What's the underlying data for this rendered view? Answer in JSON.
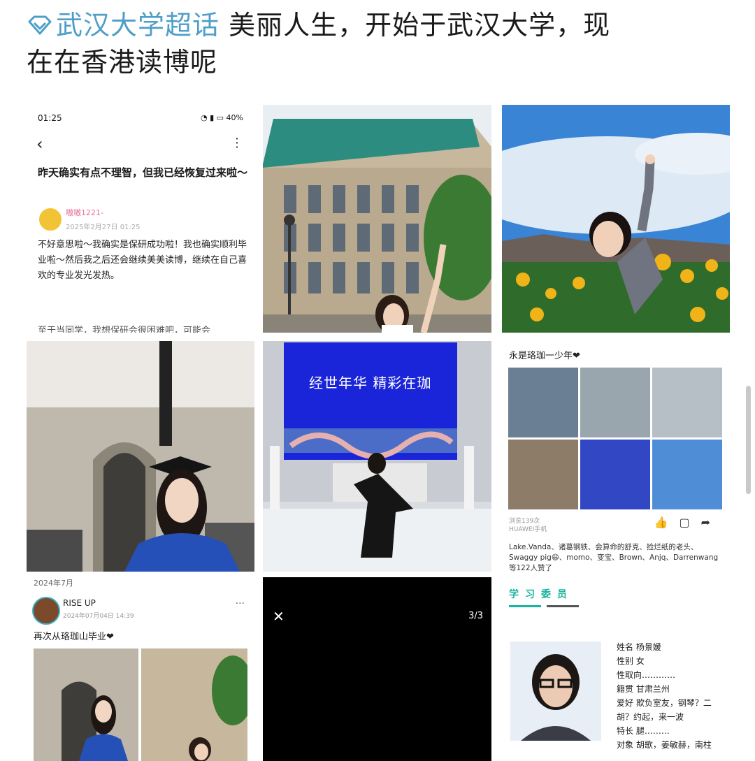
{
  "header": {
    "topic": "武汉大学超话",
    "text_line1": "美丽人生，开始于武汉大学，现",
    "text_line2": "在在香港读博呢"
  },
  "cell1": {
    "status_time": "01:25",
    "status_right": "40%",
    "title": "昨天确实有点不理智，但我已经恢复过来啦～",
    "user": "嗷嗷1221-",
    "date": "2025年2月27日 01:25",
    "body": "不好意思啦～我确实是保研成功啦！我也确实顺利毕业啦～然后我之后还会继续美美读博，继续在自己喜欢的专业发光发热。",
    "body_cut": "至于当同学，我想保研会很困难吧，可能会"
  },
  "cell5": {
    "screen_title": "经世年华  精彩在珈"
  },
  "cell6": {
    "title": "永是珞珈一少年❤",
    "views": "浏览139次",
    "device": "HUAWEI手机",
    "likes": "Lake.Vanda、诸葛钢铁、会算命的舒克、捡烂纸的老头、Swaggy pig😄、momo、变宝、Brown、Anjq、Darrenwang 等122人赞了"
  },
  "cell7": {
    "date_header": "2024年7月",
    "user": "RISE UP",
    "date": "2024年07月04日 14:39",
    "text": "再次从珞珈山毕业❤"
  },
  "cell8": {
    "counter": "3/3"
  },
  "cell9": {
    "tabs": "学习委员",
    "profile": [
      "姓名 杨景媛",
      "性别 女",
      "性取向…………",
      "籍贯 甘肃兰州",
      "爱好 欺负室友，钢琴？二",
      "胡？约起，来一波",
      "特长 腿………",
      "对象 胡歌，姜敏赫，南柱"
    ]
  },
  "colors": {
    "topic": "#4f9ec9",
    "accent_teal": "#19b3a1"
  }
}
